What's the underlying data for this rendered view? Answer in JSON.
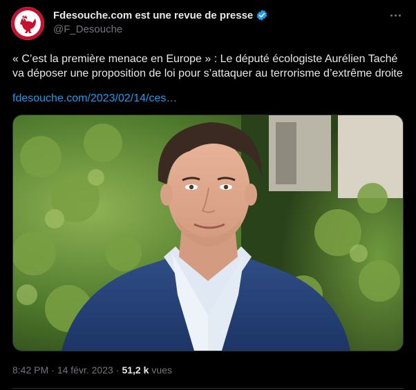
{
  "author": {
    "display_name": "Fdesouche.com est une revue de presse",
    "handle": "@F_Desouche",
    "avatar_icon": "rooster-logo-icon",
    "verified_icon": "verified-badge-icon"
  },
  "tweet": {
    "text": "« C’est la première menace en Europe » :  Le député écologiste Aurélien Taché va déposer une proposition de loi pour s’attaquer au terrorisme d’extrême droite",
    "link": "fdesouche.com/2023/02/14/ces…"
  },
  "meta": {
    "time": "8:42 PM",
    "separator1": "·",
    "date": "14 févr. 2023",
    "separator2": "·",
    "views_count": "51,2 k",
    "views_label": "vues"
  },
  "colors": {
    "background": "#000000",
    "text": "#e7e9ea",
    "muted": "#71767b",
    "link": "#1d9bf0",
    "logo_red": "#c8102e"
  }
}
